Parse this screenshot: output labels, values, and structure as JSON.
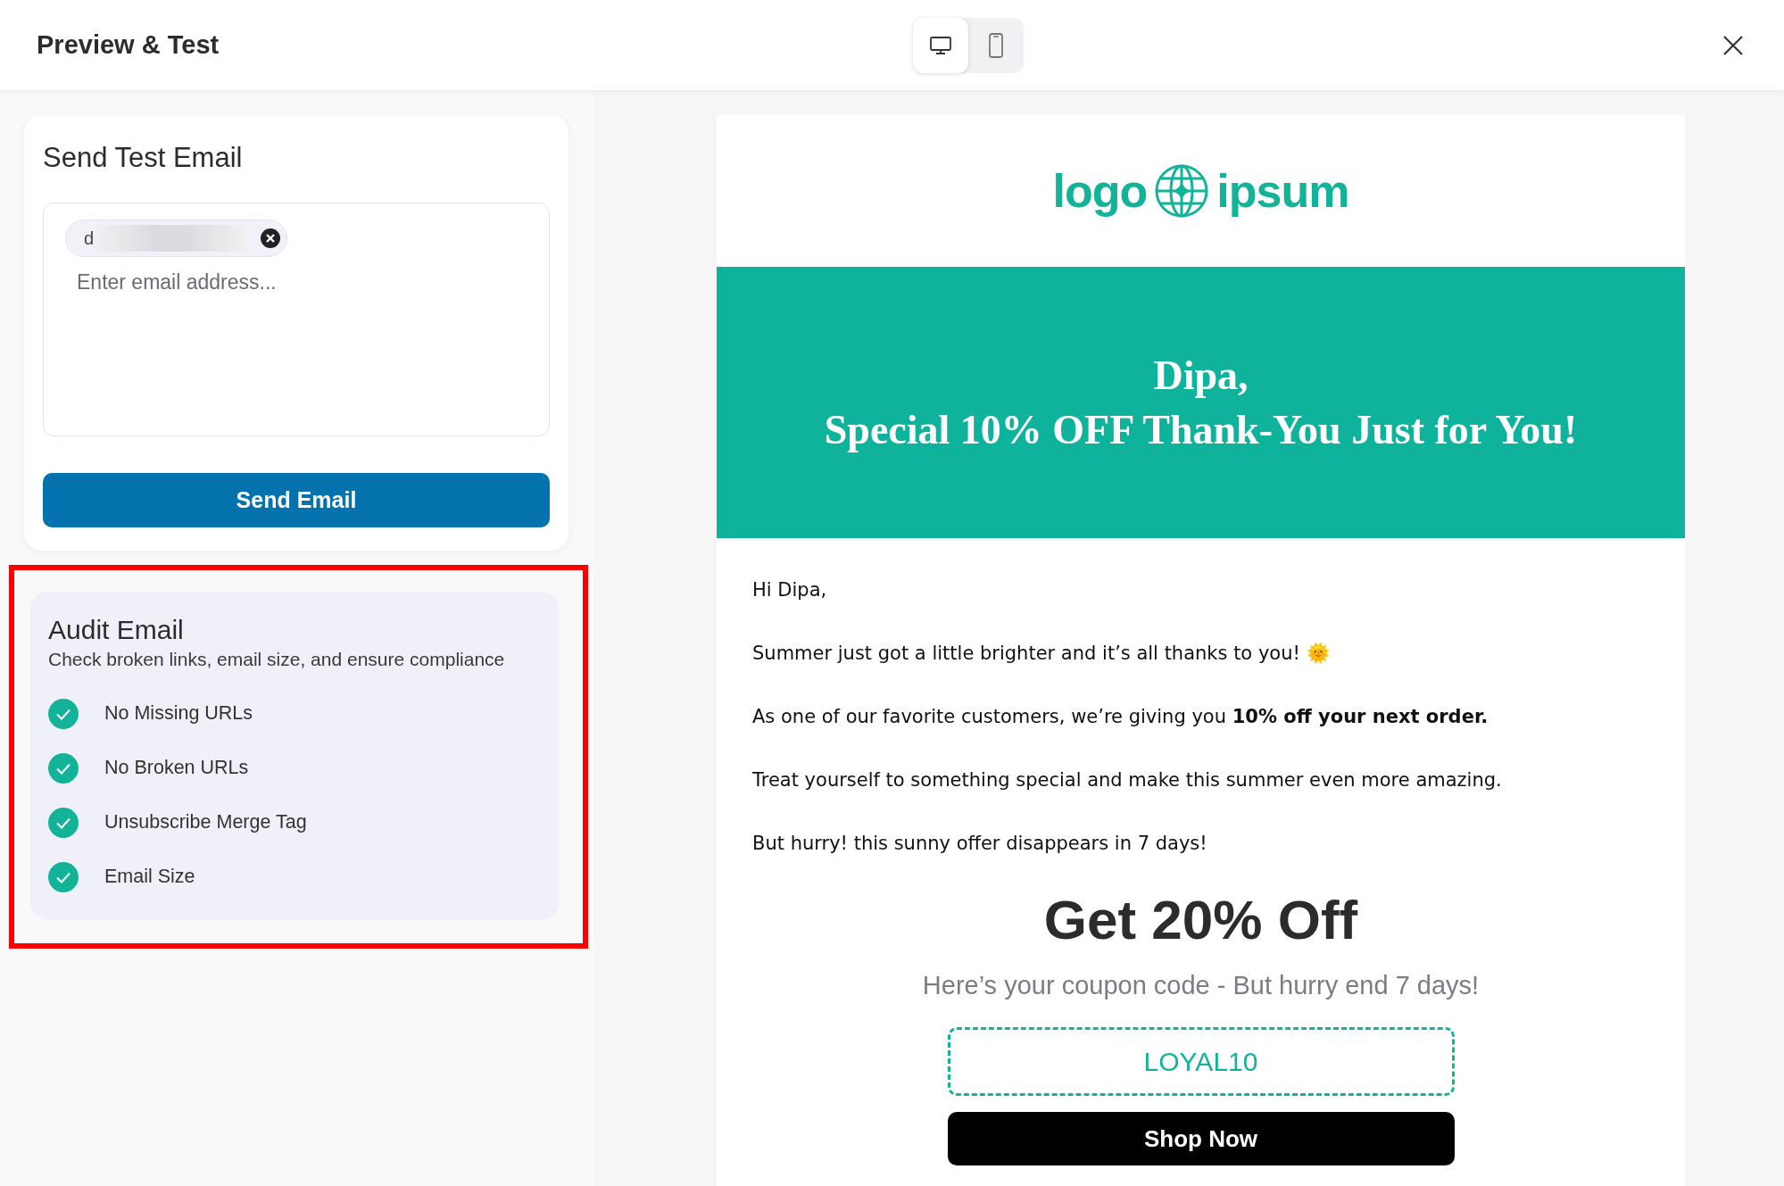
{
  "header": {
    "title": "Preview & Test",
    "view_toggle": [
      {
        "kind": "desktop",
        "selected": true
      },
      {
        "kind": "mobile",
        "selected": false
      }
    ]
  },
  "send_test": {
    "title": "Send Test Email",
    "chips": [
      {
        "text": "d",
        "redacted": true
      }
    ],
    "placeholder": "Enter email address...",
    "button": "Send Email"
  },
  "audit": {
    "highlighted": true,
    "title": "Audit Email",
    "subtitle": "Check broken links, email size, and ensure compliance",
    "checks": [
      {
        "label": "No Missing URLs",
        "passed": true
      },
      {
        "label": "No Broken URLs",
        "passed": true
      },
      {
        "label": "Unsubscribe Merge Tag",
        "passed": true
      },
      {
        "label": "Email Size",
        "passed": true
      }
    ]
  },
  "email": {
    "logo": {
      "left": "logo",
      "right": "ipsum"
    },
    "banner": {
      "lines": [
        "Dipa,",
        "Special 10% OFF Thank-You Just for You!"
      ]
    },
    "paragraphs": [
      "Hi Dipa,",
      "Summer just got a little brighter and it’s all thanks to you! 🌞",
      "As one of our favorite customers, we’re giving you **10% off your next order.**",
      "Treat yourself to something special and make this summer even more amazing.",
      "But hurry! this sunny offer disappears in 7 days!"
    ],
    "offer_title": "Get 20% Off",
    "offer_subtitle": "Here’s your coupon code - But hurry end 7 days!",
    "coupon": "LOYAL10",
    "cta": "Shop Now"
  }
}
